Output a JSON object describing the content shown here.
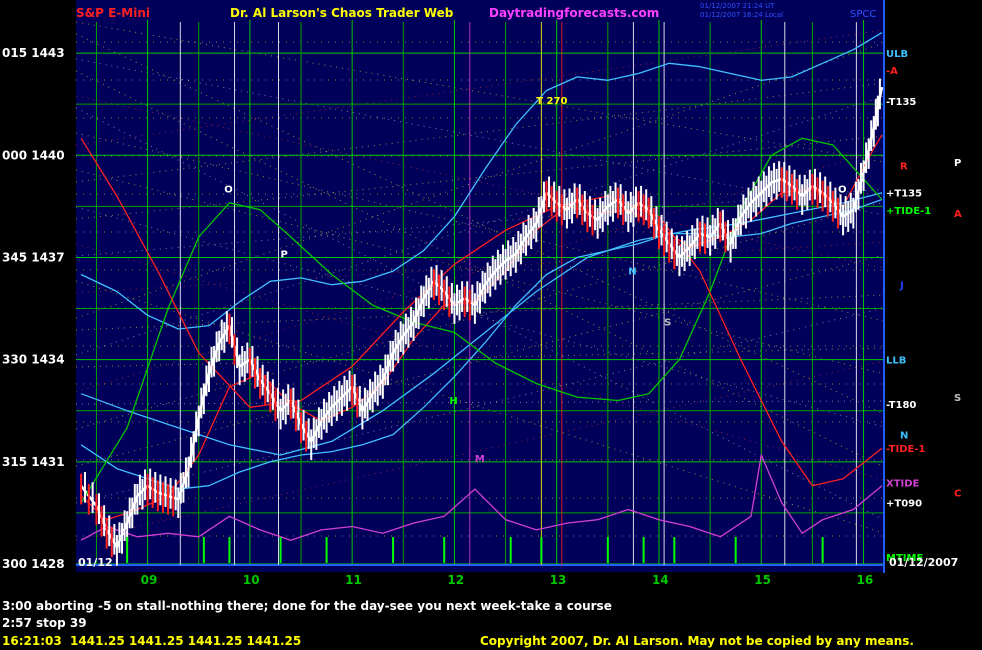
{
  "header": {
    "instrument": "S&P E-Mini",
    "title": "Dr. Al Larson's Chaos Trader Web",
    "site": "Daytradingforecasts.com",
    "stamp_line1": "01/12/2007 21:24 UT",
    "stamp_line2": "01/12/2007 16:24 Local",
    "tag": "SPCC"
  },
  "colors": {
    "background": "#000000",
    "plot_bg": "#00005a",
    "grid_green": "#00c800",
    "red": "#ff2020",
    "white": "#ffffff",
    "cyan": "#40c0ff",
    "magenta": "#d040d0",
    "yellow": "#ffff00"
  },
  "chart_data": {
    "type": "line",
    "title": "S&P E-Mini",
    "ylim": [
      1428,
      1444
    ],
    "y_ticks": [
      {
        "value": 1443,
        "label": "015 1443"
      },
      {
        "value": 1440,
        "label": "000 1440"
      },
      {
        "value": 1437,
        "label": "345 1437"
      },
      {
        "value": 1434,
        "label": "330 1434"
      },
      {
        "value": 1431,
        "label": "315 1431"
      },
      {
        "value": 1428,
        "label": "300 1428"
      }
    ],
    "x_range": [
      8.3,
      16.2
    ],
    "x_ticks": [
      "09",
      "10",
      "11",
      "12",
      "13",
      "14",
      "15",
      "16"
    ],
    "x_tick_values": [
      9,
      10,
      11,
      12,
      13,
      14,
      15,
      16
    ],
    "date_left": "01/12",
    "date_right": "01/12/2007",
    "right_labels": [
      {
        "text": "ULB",
        "value": 1443.0,
        "color": "#40c0ff"
      },
      {
        "text": "-A",
        "value": 1442.5,
        "color": "#ff2020"
      },
      {
        "text": "-T135",
        "value": 1441.6,
        "color": "#ffffff"
      },
      {
        "text": "P",
        "value": 1439.8,
        "color": "#ffffff"
      },
      {
        "text": "R",
        "value": 1439.7,
        "color": "#ff2020"
      },
      {
        "text": "+T135",
        "value": 1438.9,
        "color": "#ffffff"
      },
      {
        "text": "+TIDE-1",
        "value": 1438.4,
        "color": "#00ff00"
      },
      {
        "text": "A",
        "value": 1438.3,
        "color": "#ff2020"
      },
      {
        "text": "J",
        "value": 1436.2,
        "color": "#2040ff"
      },
      {
        "text": "LLB",
        "value": 1434.0,
        "color": "#40c0ff"
      },
      {
        "text": "-T180",
        "value": 1432.7,
        "color": "#ffffff"
      },
      {
        "text": "S",
        "value": 1432.9,
        "color": "#c0c0c0"
      },
      {
        "text": "N",
        "value": 1431.8,
        "color": "#40c0ff"
      },
      {
        "text": "-TIDE-1",
        "value": 1431.4,
        "color": "#ff2020"
      },
      {
        "text": "XTIDE",
        "value": 1430.4,
        "color": "#d040d0"
      },
      {
        "text": "C",
        "value": 1430.1,
        "color": "#ff2020"
      },
      {
        "text": "+T090",
        "value": 1429.8,
        "color": "#ffffff"
      },
      {
        "text": "MTIME",
        "value": 1428.2,
        "color": "#00ff00"
      }
    ],
    "annotations": [
      {
        "text": "T 270",
        "x": 12.8,
        "y": 1441.5,
        "color": "#ffff00"
      },
      {
        "text": "O",
        "x": 9.75,
        "y": 1438.9,
        "color": "#ffffff"
      },
      {
        "text": "P",
        "x": 10.3,
        "y": 1437.0,
        "color": "#ffffff"
      },
      {
        "text": "H",
        "x": 11.95,
        "y": 1432.7,
        "color": "#00ff00"
      },
      {
        "text": "M",
        "x": 12.2,
        "y": 1431.0,
        "color": "#d040d0"
      },
      {
        "text": "N",
        "x": 13.7,
        "y": 1436.5,
        "color": "#40c0ff"
      },
      {
        "text": "S",
        "x": 14.05,
        "y": 1435.0,
        "color": "#c0c0c0"
      },
      {
        "text": "O",
        "x": 15.75,
        "y": 1438.9,
        "color": "#ffffff"
      }
    ],
    "vlines": [
      {
        "x": 9.32,
        "color": "#ffffff"
      },
      {
        "x": 9.85,
        "color": "#ffffff"
      },
      {
        "x": 10.28,
        "color": "#ffffff"
      },
      {
        "x": 12.15,
        "color": "#d040d0"
      },
      {
        "x": 12.85,
        "color": "#ffff00"
      },
      {
        "x": 13.05,
        "color": "#ff2020"
      },
      {
        "x": 13.75,
        "color": "#ffffff"
      },
      {
        "x": 14.05,
        "color": "#ffffff"
      },
      {
        "x": 15.23,
        "color": "#ffffff"
      },
      {
        "x": 15.93,
        "color": "#ffffff"
      }
    ],
    "series": [
      {
        "name": "price",
        "color": "#ffffff",
        "x": [
          8.35,
          8.5,
          8.6,
          8.7,
          8.8,
          8.9,
          9.0,
          9.1,
          9.2,
          9.3,
          9.4,
          9.5,
          9.6,
          9.7,
          9.8,
          9.9,
          10.0,
          10.1,
          10.2,
          10.3,
          10.4,
          10.5,
          10.6,
          10.7,
          10.8,
          10.9,
          11.0,
          11.1,
          11.2,
          11.3,
          11.4,
          11.5,
          11.6,
          11.7,
          11.8,
          11.9,
          12.0,
          12.1,
          12.2,
          12.3,
          12.4,
          12.5,
          12.6,
          12.7,
          12.8,
          12.9,
          13.0,
          13.1,
          13.2,
          13.3,
          13.4,
          13.5,
          13.6,
          13.7,
          13.8,
          13.9,
          14.0,
          14.1,
          14.2,
          14.3,
          14.4,
          14.5,
          14.6,
          14.7,
          14.8,
          14.9,
          15.0,
          15.1,
          15.2,
          15.3,
          15.4,
          15.5,
          15.6,
          15.7,
          15.8,
          15.9,
          16.0,
          16.1,
          16.18
        ],
        "y": [
          1430.3,
          1429.7,
          1429.0,
          1428.5,
          1429.2,
          1430.0,
          1430.3,
          1430.1,
          1430.0,
          1429.9,
          1430.8,
          1432.3,
          1433.6,
          1434.5,
          1435.0,
          1433.8,
          1434.0,
          1433.4,
          1433.0,
          1432.5,
          1432.8,
          1432.1,
          1431.6,
          1432.2,
          1432.6,
          1432.9,
          1433.2,
          1432.5,
          1433.0,
          1433.4,
          1434.2,
          1434.7,
          1435.1,
          1435.8,
          1436.3,
          1436.0,
          1435.6,
          1435.8,
          1435.6,
          1436.2,
          1436.6,
          1436.9,
          1437.1,
          1437.6,
          1438.0,
          1438.9,
          1438.6,
          1438.4,
          1438.7,
          1438.3,
          1438.1,
          1438.5,
          1438.7,
          1438.3,
          1438.6,
          1438.4,
          1437.8,
          1437.4,
          1437.0,
          1437.3,
          1437.7,
          1437.6,
          1438.0,
          1437.4,
          1438.2,
          1438.6,
          1438.9,
          1439.2,
          1439.3,
          1439.1,
          1438.8,
          1439.1,
          1438.9,
          1438.6,
          1438.2,
          1438.4,
          1439.5,
          1440.8,
          1442.0
        ]
      },
      {
        "name": "fast_avg",
        "color": "#ff2020",
        "x": [
          8.35,
          8.6,
          8.9,
          9.2,
          9.5,
          9.8,
          10.1,
          10.4,
          10.7,
          11.0,
          11.3,
          11.6,
          11.9,
          12.2,
          12.5,
          12.8,
          13.1,
          13.4,
          13.7,
          14.0,
          14.3,
          14.6,
          14.9,
          15.2,
          15.5,
          15.8,
          16.1,
          16.18
        ],
        "y": [
          1430.0,
          1429.3,
          1429.6,
          1430.0,
          1431.2,
          1433.2,
          1433.6,
          1432.7,
          1432.2,
          1432.6,
          1433.3,
          1434.6,
          1435.6,
          1435.7,
          1436.6,
          1437.8,
          1438.5,
          1438.3,
          1438.4,
          1437.9,
          1437.3,
          1437.6,
          1438.1,
          1438.9,
          1439.0,
          1438.5,
          1440.2,
          1440.6
        ]
      },
      {
        "name": "cyan_upper",
        "color": "#40c0ff",
        "x": [
          8.35,
          8.7,
          9.0,
          9.3,
          9.6,
          9.9,
          10.2,
          10.5,
          10.8,
          11.1,
          11.4,
          11.7,
          12.0,
          12.3,
          12.6,
          12.9,
          13.2,
          13.5,
          13.8,
          14.1,
          14.4,
          14.7,
          15.0,
          15.3,
          15.6,
          15.9,
          16.18
        ],
        "y": [
          1436.5,
          1436.0,
          1435.3,
          1434.9,
          1435.0,
          1435.7,
          1436.3,
          1436.4,
          1436.2,
          1436.3,
          1436.6,
          1437.2,
          1438.2,
          1439.6,
          1440.9,
          1441.9,
          1442.3,
          1442.2,
          1442.4,
          1442.7,
          1442.6,
          1442.4,
          1442.2,
          1442.3,
          1442.7,
          1443.1,
          1443.6
        ]
      },
      {
        "name": "cyan_lower",
        "color": "#40c0ff",
        "x": [
          8.35,
          8.7,
          9.0,
          9.3,
          9.6,
          9.9,
          10.2,
          10.5,
          10.8,
          11.1,
          11.4,
          11.7,
          12.0,
          12.3,
          12.6,
          12.9,
          13.2,
          13.5,
          13.8,
          14.1,
          14.4,
          14.7,
          15.0,
          15.3,
          15.6,
          15.9,
          16.18
        ],
        "y": [
          1431.5,
          1430.8,
          1430.5,
          1430.2,
          1430.3,
          1430.7,
          1431.0,
          1431.2,
          1431.3,
          1431.5,
          1431.8,
          1432.6,
          1433.5,
          1434.5,
          1435.6,
          1436.5,
          1437.0,
          1437.2,
          1437.4,
          1437.7,
          1437.7,
          1437.6,
          1437.7,
          1438.0,
          1438.2,
          1438.4,
          1438.7
        ]
      },
      {
        "name": "cyan_mid",
        "color": "#40c0ff",
        "x": [
          8.35,
          8.8,
          9.3,
          9.8,
          10.3,
          10.8,
          11.3,
          11.8,
          12.3,
          12.8,
          13.3,
          13.8,
          14.3,
          14.8,
          15.3,
          15.8,
          16.18
        ],
        "y": [
          1433.0,
          1432.5,
          1432.0,
          1431.5,
          1431.2,
          1431.6,
          1432.5,
          1433.6,
          1434.8,
          1436.0,
          1437.0,
          1437.5,
          1437.8,
          1438.0,
          1438.3,
          1438.6,
          1438.9
        ]
      },
      {
        "name": "green_cycle",
        "color": "#00c800",
        "x": [
          8.35,
          8.8,
          9.2,
          9.5,
          9.8,
          10.1,
          10.4,
          10.8,
          11.2,
          11.6,
          12.0,
          12.4,
          12.8,
          13.2,
          13.6,
          13.9,
          14.2,
          14.5,
          14.8,
          15.1,
          15.4,
          15.7,
          16.0,
          16.18
        ],
        "y": [
          1429.8,
          1432.0,
          1435.5,
          1437.6,
          1438.6,
          1438.4,
          1437.6,
          1436.5,
          1435.6,
          1435.1,
          1434.8,
          1433.9,
          1433.3,
          1432.9,
          1432.8,
          1433.0,
          1434.0,
          1436.0,
          1438.4,
          1440.0,
          1440.5,
          1440.3,
          1439.3,
          1438.7
        ]
      },
      {
        "name": "red_cycle",
        "color": "#ff2020",
        "x": [
          8.35,
          8.7,
          9.1,
          9.5,
          10.0,
          10.5,
          11.0,
          11.5,
          12.0,
          12.5,
          13.0,
          13.5,
          14.0,
          14.4,
          14.8,
          15.2,
          15.5,
          15.8,
          16.18
        ],
        "y": [
          1440.5,
          1438.8,
          1436.6,
          1434.2,
          1432.6,
          1432.8,
          1433.8,
          1435.4,
          1436.8,
          1437.8,
          1438.5,
          1438.8,
          1438.2,
          1436.6,
          1434.0,
          1431.6,
          1430.3,
          1430.5,
          1431.4
        ]
      },
      {
        "name": "magenta_osc",
        "color": "#d040d0",
        "x": [
          8.35,
          8.6,
          8.9,
          9.2,
          9.5,
          9.8,
          10.1,
          10.4,
          10.7,
          11.0,
          11.3,
          11.6,
          11.9,
          12.2,
          12.5,
          12.8,
          13.1,
          13.4,
          13.7,
          14.0,
          14.3,
          14.6,
          14.9,
          15.0,
          15.2,
          15.4,
          15.6,
          15.9,
          16.18
        ],
        "y": [
          1428.7,
          1429.1,
          1428.8,
          1428.9,
          1428.8,
          1429.4,
          1429.0,
          1428.7,
          1429.0,
          1429.1,
          1428.9,
          1429.2,
          1429.4,
          1430.2,
          1429.3,
          1429.0,
          1429.2,
          1429.3,
          1429.6,
          1429.3,
          1429.1,
          1428.8,
          1429.4,
          1431.2,
          1429.8,
          1428.9,
          1429.3,
          1429.6,
          1430.3
        ]
      }
    ]
  },
  "footer": {
    "line1": "3:00 aborting -5 on stall-nothing there; done for the day-see you next week-take a course",
    "line2": "2:57 stop 39",
    "quote": "16:21:03  1441.25 1441.25 1441.25 1441.25",
    "copyright": "Copyright 2007, Dr. Al Larson. May not be copied by any means."
  }
}
